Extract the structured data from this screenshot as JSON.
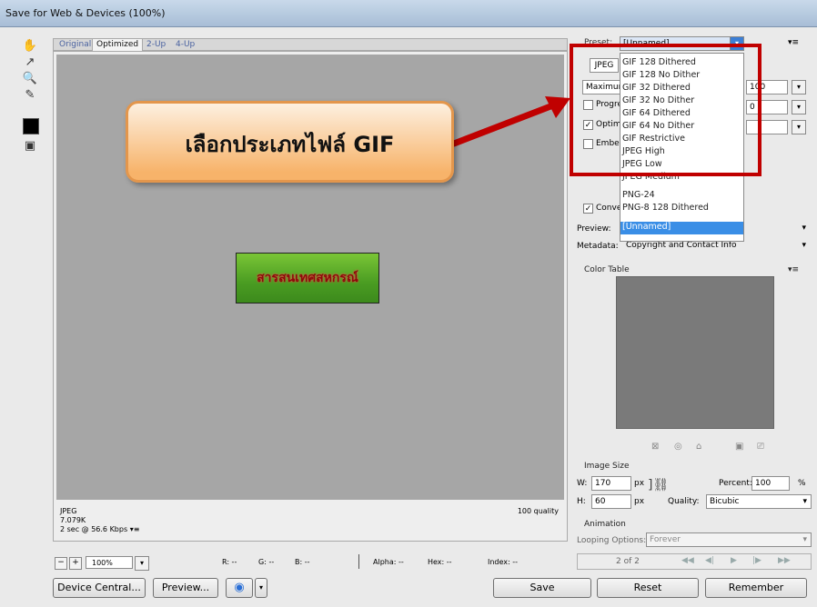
{
  "window": {
    "title": "Save for Web & Devices (100%)"
  },
  "view_tabs": [
    "Original",
    "Optimized",
    "2-Up",
    "4-Up"
  ],
  "image": {
    "text": "สารสนเทศสหกรณ์"
  },
  "status_left": {
    "format": "JPEG",
    "size": "7.079K",
    "time": "2 sec @ 56.6 Kbps"
  },
  "status_right": "100 quality",
  "zoom": {
    "value": "100%"
  },
  "readouts": {
    "r": "R: --",
    "g": "G: --",
    "b": "B: --",
    "alpha": "Alpha: --",
    "hex": "Hex: --",
    "index": "Index: --"
  },
  "buttons": {
    "device_central": "Device Central...",
    "preview": "Preview...",
    "save": "Save",
    "reset": "Reset",
    "remember": "Remember"
  },
  "settings": {
    "preset_label": "Preset:",
    "preset_value": "[Unnamed]",
    "format_value": "JPEG",
    "quality_level": "Maximum",
    "quality_value": "100",
    "quality2": "0",
    "progressive": "Progre",
    "optimized": "Optim",
    "embed": "Embed",
    "convert": "Conve",
    "preview_label": "Preview:",
    "metadata_label": "Metadata:",
    "metadata_value": "Copyright and Contact Info"
  },
  "menu": {
    "items": [
      "GIF 128 Dithered",
      "GIF 128 No Dither",
      "GIF 32 Dithered",
      "GIF 32 No Dither",
      "GIF 64 Dithered",
      "GIF 64 No Dither",
      "GIF Restrictive",
      "JPEG High",
      "JPEG Low",
      "JPEG Medium",
      "PNG-24",
      "PNG-8 128 Dithered"
    ],
    "selected": "[Unnamed]"
  },
  "color_table": {
    "title": "Color Table"
  },
  "image_size": {
    "title": "Image Size",
    "w_label": "W:",
    "w": "170",
    "h_label": "H:",
    "h": "60",
    "unit": "px",
    "percent_label": "Percent:",
    "percent": "100",
    "percent_unit": "%",
    "quality_label": "Quality:",
    "quality": "Bicubic"
  },
  "animation": {
    "title": "Animation",
    "looping_label": "Looping Options:",
    "looping": "Forever",
    "frame": "2 of 2"
  },
  "annotation": {
    "text": "เลือกประเภทไฟล์ GIF",
    "color": "#c00000"
  }
}
